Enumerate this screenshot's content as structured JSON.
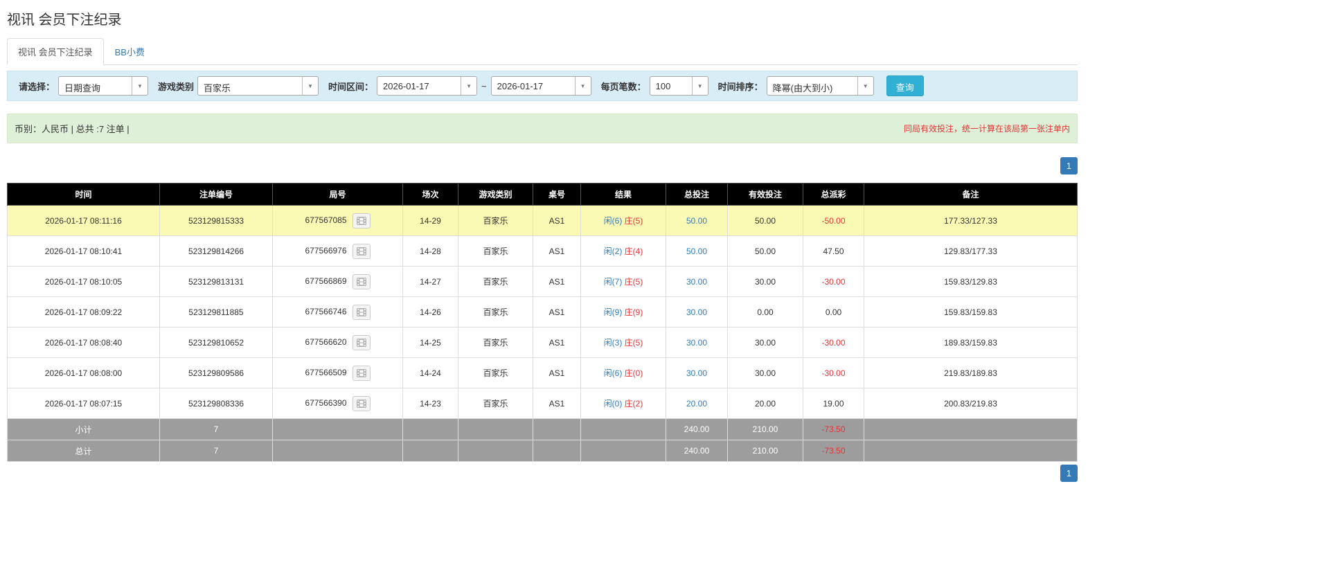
{
  "page": {
    "title": "视讯 会员下注纪录"
  },
  "tabs": [
    {
      "label": "视讯 会员下注纪录",
      "active": true
    },
    {
      "label": "BB小费",
      "active": false
    }
  ],
  "filters": {
    "select_label": "请选择：",
    "select_value": "日期查询",
    "game_label": "游戏类别",
    "game_value": "百家乐",
    "range_label": "时间区间：",
    "date_from": "2026-01-17",
    "date_separator": "~",
    "date_to": "2026-01-17",
    "per_page_label": "每页笔数：",
    "per_page_value": "100",
    "sort_label": "时间排序：",
    "sort_value": "降幂(由大到小)",
    "search_button": "查询"
  },
  "notice": {
    "left": "币别：人民币 | 总共 :7 注单 |",
    "right": "同局有效投注，统一计算在该局第一张注单内"
  },
  "pagination": {
    "current_page": "1"
  },
  "icons": {
    "dropdown_caret": "caret-down-icon",
    "round_action": "video-replay-icon"
  },
  "colors": {
    "link_blue": "#337ab7",
    "negative_red": "#e53333",
    "highlight_yellow": "#fafab4",
    "header_black": "#000000",
    "summary_gray": "#9d9d9d",
    "filter_bg": "#d9edf7",
    "notice_bg": "#dff0d8",
    "search_button_bg": "#31b0d5"
  },
  "table": {
    "headers": [
      "时间",
      "注单编号",
      "局号",
      "场次",
      "游戏类别",
      "桌号",
      "结果",
      "总投注",
      "有效投注",
      "总派彩",
      "备注"
    ],
    "rows": [
      {
        "time": "2026-01-17 08:11:16",
        "bet_id": "523129815333",
        "round": "677567085",
        "session": "14-29",
        "game": "百家乐",
        "table_no": "AS1",
        "result_player": "闲(6)",
        "result_banker": "庄(5)",
        "total_bet": "50.00",
        "valid_bet": "50.00",
        "payout": "-50.00",
        "note": "177.33/127.33",
        "highlight": true
      },
      {
        "time": "2026-01-17 08:10:41",
        "bet_id": "523129814266",
        "round": "677566976",
        "session": "14-28",
        "game": "百家乐",
        "table_no": "AS1",
        "result_player": "闲(2)",
        "result_banker": "庄(4)",
        "total_bet": "50.00",
        "valid_bet": "50.00",
        "payout": "47.50",
        "note": "129.83/177.33",
        "highlight": false
      },
      {
        "time": "2026-01-17 08:10:05",
        "bet_id": "523129813131",
        "round": "677566869",
        "session": "14-27",
        "game": "百家乐",
        "table_no": "AS1",
        "result_player": "闲(7)",
        "result_banker": "庄(5)",
        "total_bet": "30.00",
        "valid_bet": "30.00",
        "payout": "-30.00",
        "note": "159.83/129.83",
        "highlight": false
      },
      {
        "time": "2026-01-17 08:09:22",
        "bet_id": "523129811885",
        "round": "677566746",
        "session": "14-26",
        "game": "百家乐",
        "table_no": "AS1",
        "result_player": "闲(9)",
        "result_banker": "庄(9)",
        "total_bet": "30.00",
        "valid_bet": "0.00",
        "payout": "0.00",
        "note": "159.83/159.83",
        "highlight": false
      },
      {
        "time": "2026-01-17 08:08:40",
        "bet_id": "523129810652",
        "round": "677566620",
        "session": "14-25",
        "game": "百家乐",
        "table_no": "AS1",
        "result_player": "闲(3)",
        "result_banker": "庄(5)",
        "total_bet": "30.00",
        "valid_bet": "30.00",
        "payout": "-30.00",
        "note": "189.83/159.83",
        "highlight": false
      },
      {
        "time": "2026-01-17 08:08:00",
        "bet_id": "523129809586",
        "round": "677566509",
        "session": "14-24",
        "game": "百家乐",
        "table_no": "AS1",
        "result_player": "闲(6)",
        "result_banker": "庄(0)",
        "total_bet": "30.00",
        "valid_bet": "30.00",
        "payout": "-30.00",
        "note": "219.83/189.83",
        "highlight": false
      },
      {
        "time": "2026-01-17 08:07:15",
        "bet_id": "523129808336",
        "round": "677566390",
        "session": "14-23",
        "game": "百家乐",
        "table_no": "AS1",
        "result_player": "闲(0)",
        "result_banker": "庄(2)",
        "total_bet": "20.00",
        "valid_bet": "20.00",
        "payout": "19.00",
        "note": "200.83/219.83",
        "highlight": false
      }
    ],
    "subtotal": {
      "label": "小计",
      "count": "7",
      "total_bet": "240.00",
      "valid_bet": "210.00",
      "payout": "-73.50"
    },
    "total": {
      "label": "总计",
      "count": "7",
      "total_bet": "240.00",
      "valid_bet": "210.00",
      "payout": "-73.50"
    }
  }
}
